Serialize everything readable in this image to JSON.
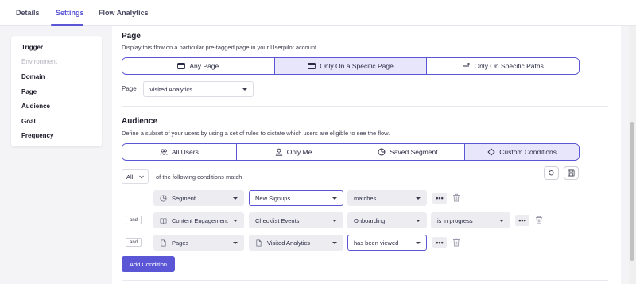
{
  "tabs": [
    "Details",
    "Settings",
    "Flow Analytics"
  ],
  "sidebar": [
    "Trigger",
    "Environment",
    "Domain",
    "Page",
    "Audience",
    "Goal",
    "Frequency"
  ],
  "page_section": {
    "title": "Page",
    "description": "Display this flow on a particular pre-tagged page in your Userpilot account.",
    "options": [
      "Any Page",
      "Only On a Specific Page",
      "Only On Specific Paths"
    ],
    "selected": "Only On a Specific Page",
    "field_label": "Page",
    "field_value": "Visited Analytics"
  },
  "audience": {
    "title": "Audience",
    "description": "Define a subset of your users by using a set of rules to dictate which users are eligible to see the flow.",
    "options": [
      "All Users",
      "Only Me",
      "Saved Segment",
      "Custom Conditions"
    ],
    "selected": "Custom Conditions",
    "match_value": "All",
    "match_text": "of the following conditions match",
    "conditions": [
      {
        "connector": "",
        "type": "Segment",
        "value": "New Signups",
        "operator": "matches",
        "extra": ""
      },
      {
        "connector": "and",
        "type": "Content Engagement",
        "value": "Checklist Events",
        "operator": "Onboarding",
        "extra": "is in progress"
      },
      {
        "connector": "and",
        "type": "Pages",
        "value": "Visited Analytics",
        "operator": "has been viewed",
        "extra": ""
      }
    ],
    "more_label": "•••",
    "add_button": "Add Condition"
  }
}
